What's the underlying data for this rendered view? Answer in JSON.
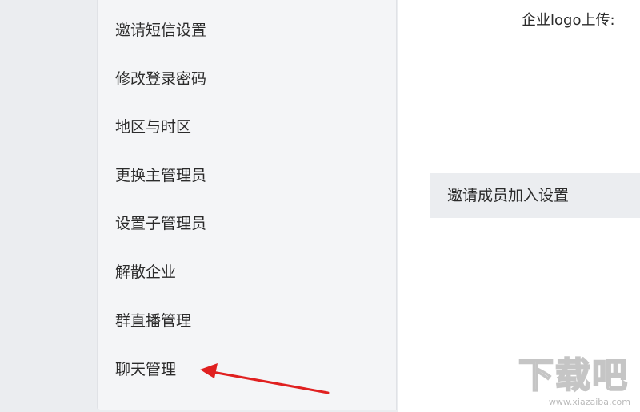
{
  "sidebar": {
    "items": [
      {
        "label": "邀请短信设置"
      },
      {
        "label": "修改登录密码"
      },
      {
        "label": "地区与时区"
      },
      {
        "label": "更换主管理员"
      },
      {
        "label": "设置子管理员"
      },
      {
        "label": "解散企业"
      },
      {
        "label": "群直播管理"
      },
      {
        "label": "聊天管理"
      }
    ]
  },
  "main": {
    "logo_upload_label": "企业logo上传:",
    "invite_settings_label": "邀请成员加入设置"
  },
  "annotation": {
    "arrow_color": "#e02020"
  },
  "watermark": {
    "text": "下载吧",
    "sub": "www.xiazaiba.com"
  }
}
